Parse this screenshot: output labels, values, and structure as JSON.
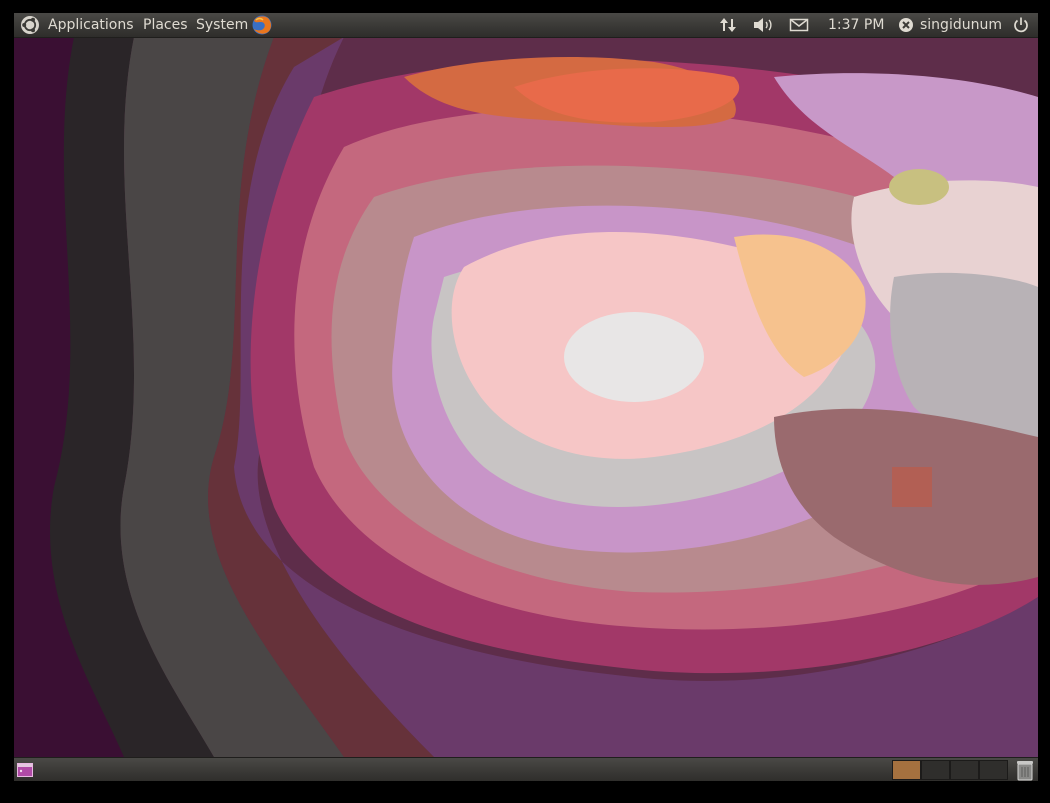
{
  "top_panel": {
    "menus": {
      "applications": "Applications",
      "places": "Places",
      "system": "System"
    },
    "clock": "1:37 PM",
    "username": "singidunum",
    "icons": [
      "ubuntu-logo-icon",
      "firefox-icon",
      "network-updown-icon",
      "volume-icon",
      "mail-envelope-icon",
      "user-status-icon",
      "power-icon"
    ]
  },
  "bottom_panel": {
    "workspaces": [
      {
        "active": true,
        "color": "#a5713f"
      },
      {
        "active": false,
        "color": "#2f2e2c"
      },
      {
        "active": false,
        "color": "#2f2e2c"
      },
      {
        "active": false,
        "color": "#2f2e2c"
      }
    ],
    "icons": [
      "show-desktop-icon",
      "trash-icon"
    ]
  },
  "colors": {
    "panel": "#3c3b37",
    "panel_text": "#dfdbd2",
    "wallpaper_base": "#5a2842"
  }
}
